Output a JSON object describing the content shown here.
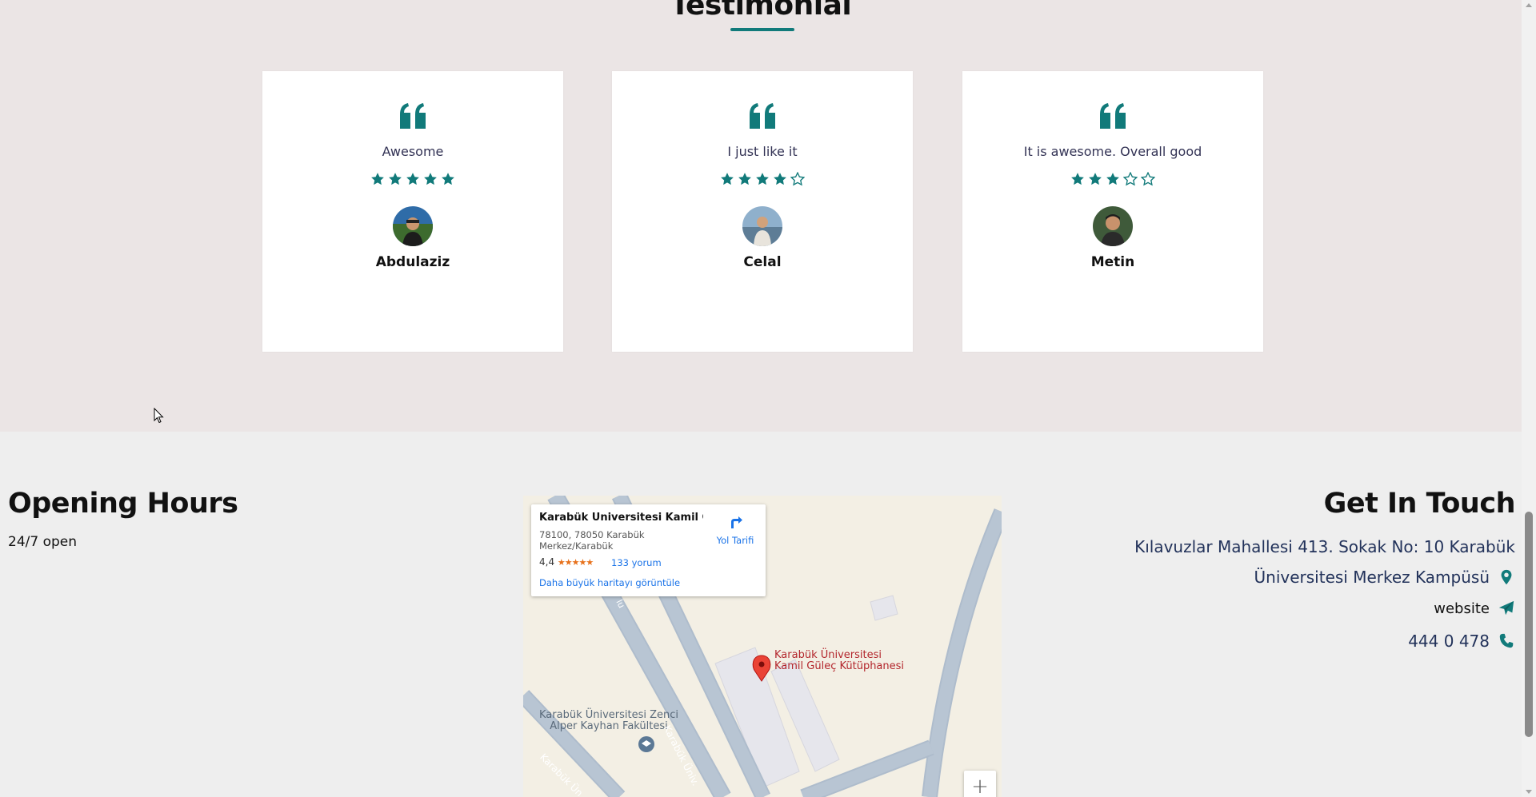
{
  "testimonial": {
    "title": "Testimonial",
    "accent_color": "#117a7a",
    "cards": [
      {
        "quote": "Awesome",
        "rating": 5,
        "max_rating": 5,
        "name": "Abdulaziz",
        "icon": "quote-icon"
      },
      {
        "quote": "I just like it",
        "rating": 4,
        "max_rating": 5,
        "name": "Celal",
        "icon": "quote-icon"
      },
      {
        "quote": "It is awesome. Overall good",
        "rating": 3,
        "max_rating": 5,
        "name": "Metin",
        "icon": "quote-icon"
      }
    ]
  },
  "opening_hours": {
    "title": "Opening Hours",
    "text": "24/7 open"
  },
  "map": {
    "place_name": "Karabük Üniversitesi Kamil Gü...",
    "address_line1": "78100, 78050 Karabük",
    "address_line2": "Merkez/Karabük",
    "rating": "4,4",
    "rating_stars": "★★★★★",
    "reviews": "133 yorum",
    "directions": "Yol Tarifi",
    "larger_map_link": "Daha büyük haritayı görüntüle",
    "marker_label_line1": "Karabük Üniversitesi",
    "marker_label_line2": "Kamil Güleç Kütüphanesi",
    "poi_label_line1": "Karabük Üniversitesi Zenci",
    "poi_label_line2": "Alper Kayhan Fakültesi",
    "road_label1": "Karabük Üniv.",
    "road_label2": "Karabük Ün",
    "road_label3": "lu",
    "zoom_in": "+"
  },
  "contact": {
    "title": "Get In Touch",
    "address_line1": "Kılavuzlar Mahallesi 413. Sokak No: 10 Karabük",
    "address_line2": "Üniversitesi Merkez Kampüsü",
    "website": "website",
    "phone": "444 0 478",
    "icon_color": "#117a7a"
  }
}
